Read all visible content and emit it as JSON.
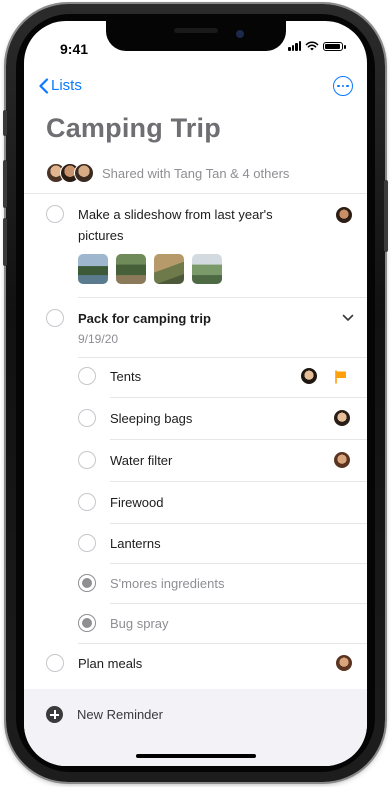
{
  "status_bar": {
    "time": "9:41"
  },
  "nav": {
    "back_label": "Lists"
  },
  "list": {
    "title": "Camping Trip",
    "shared_text": "Shared with Tang Tan & 4 others"
  },
  "reminders": [
    {
      "label": "Make a slideshow from last year's",
      "label_line2": "pictures",
      "completed": false,
      "has_assignee": true
    },
    {
      "label": "Pack for camping trip",
      "date": "9/19/20",
      "completed": false,
      "expanded": true
    }
  ],
  "subtasks": [
    {
      "label": "Tents",
      "completed": false,
      "flagged": true
    },
    {
      "label": "Sleeping bags",
      "completed": false
    },
    {
      "label": "Water filter",
      "completed": false
    },
    {
      "label": "Firewood",
      "completed": false
    },
    {
      "label": "Lanterns",
      "completed": false
    },
    {
      "label": "S'mores ingredients",
      "completed": true
    },
    {
      "label": "Bug spray",
      "completed": true
    }
  ],
  "last_reminder": {
    "label": "Plan meals",
    "completed": false
  },
  "footer": {
    "new_reminder_label": "New Reminder"
  },
  "colors": {
    "accent": "#0a7aff",
    "flag": "#ff9f0a",
    "title": "#6e6e73",
    "muted": "#8e8e93"
  },
  "icons": [
    "chevron-left-icon",
    "more-icon",
    "chevron-down-icon",
    "flag-icon",
    "plus-circle-icon"
  ]
}
